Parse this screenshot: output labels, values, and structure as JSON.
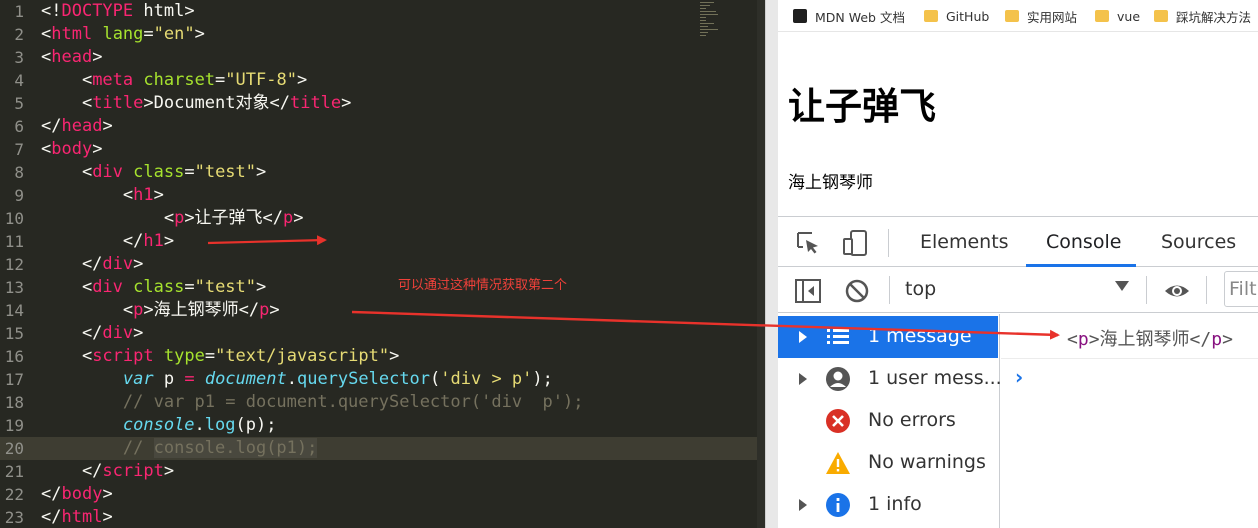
{
  "editor": {
    "lines": [
      {
        "n": "1",
        "parts": [
          [
            "p",
            "<!"
          ],
          [
            "tag",
            "DOCTYPE"
          ],
          [
            "p",
            " html>"
          ]
        ]
      },
      {
        "n": "2",
        "parts": [
          [
            "p",
            "<"
          ],
          [
            "tag",
            "html"
          ],
          [
            "p",
            " "
          ],
          [
            "attr",
            "lang"
          ],
          [
            "p",
            "="
          ],
          [
            "str",
            "\"en\""
          ],
          [
            "p",
            ">"
          ]
        ]
      },
      {
        "n": "3",
        "parts": [
          [
            "p",
            "<"
          ],
          [
            "tag",
            "head"
          ],
          [
            "p",
            ">"
          ]
        ]
      },
      {
        "n": "4",
        "parts": [
          [
            "p",
            "    <"
          ],
          [
            "tag",
            "meta"
          ],
          [
            "p",
            " "
          ],
          [
            "attr",
            "charset"
          ],
          [
            "p",
            "="
          ],
          [
            "str",
            "\"UTF-8\""
          ],
          [
            "p",
            ">"
          ]
        ]
      },
      {
        "n": "5",
        "parts": [
          [
            "p",
            "    <"
          ],
          [
            "tag",
            "title"
          ],
          [
            "p",
            ">Document对象</"
          ],
          [
            "tag",
            "title"
          ],
          [
            "p",
            ">"
          ]
        ]
      },
      {
        "n": "6",
        "parts": [
          [
            "p",
            "</"
          ],
          [
            "tag",
            "head"
          ],
          [
            "p",
            ">"
          ]
        ]
      },
      {
        "n": "7",
        "parts": [
          [
            "p",
            "<"
          ],
          [
            "tag",
            "body"
          ],
          [
            "p",
            ">"
          ]
        ]
      },
      {
        "n": "8",
        "parts": [
          [
            "p",
            "    <"
          ],
          [
            "tag",
            "div"
          ],
          [
            "p",
            " "
          ],
          [
            "attr",
            "class"
          ],
          [
            "p",
            "="
          ],
          [
            "str",
            "\"test\""
          ],
          [
            "p",
            ">"
          ]
        ]
      },
      {
        "n": "9",
        "parts": [
          [
            "p",
            "        <"
          ],
          [
            "tag",
            "h1"
          ],
          [
            "p",
            ">"
          ]
        ]
      },
      {
        "n": "10",
        "parts": [
          [
            "p",
            "            <"
          ],
          [
            "tag",
            "p"
          ],
          [
            "p",
            ">让子弹飞</"
          ],
          [
            "tag",
            "p"
          ],
          [
            "p",
            ">"
          ]
        ]
      },
      {
        "n": "11",
        "parts": [
          [
            "p",
            "        </"
          ],
          [
            "tag",
            "h1"
          ],
          [
            "p",
            ">"
          ]
        ]
      },
      {
        "n": "12",
        "parts": [
          [
            "p",
            "    </"
          ],
          [
            "tag",
            "div"
          ],
          [
            "p",
            ">"
          ]
        ]
      },
      {
        "n": "13",
        "parts": [
          [
            "p",
            "    <"
          ],
          [
            "tag",
            "div"
          ],
          [
            "p",
            " "
          ],
          [
            "attr",
            "class"
          ],
          [
            "p",
            "="
          ],
          [
            "str",
            "\"test\""
          ],
          [
            "p",
            ">"
          ]
        ]
      },
      {
        "n": "14",
        "parts": [
          [
            "p",
            "        <"
          ],
          [
            "tag",
            "p"
          ],
          [
            "p",
            ">海上钢琴师</"
          ],
          [
            "tag",
            "p"
          ],
          [
            "p",
            ">"
          ]
        ]
      },
      {
        "n": "15",
        "parts": [
          [
            "p",
            "    </"
          ],
          [
            "tag",
            "div"
          ],
          [
            "p",
            ">"
          ]
        ]
      },
      {
        "n": "16",
        "parts": [
          [
            "p",
            "    <"
          ],
          [
            "tag",
            "script"
          ],
          [
            "p",
            " "
          ],
          [
            "attr",
            "type"
          ],
          [
            "p",
            "="
          ],
          [
            "str",
            "\"text/javascript\""
          ],
          [
            "p",
            ">"
          ]
        ]
      },
      {
        "n": "17",
        "parts": [
          [
            "p",
            "        "
          ],
          [
            "kw",
            "var"
          ],
          [
            "p",
            " p "
          ],
          [
            "tag",
            "="
          ],
          [
            "p",
            " "
          ],
          [
            "kw",
            "document"
          ],
          [
            "p",
            "."
          ],
          [
            "fn",
            "querySelector"
          ],
          [
            "p",
            "("
          ],
          [
            "str",
            "'div > p'"
          ],
          [
            "p",
            ");"
          ]
        ]
      },
      {
        "n": "18",
        "parts": [
          [
            "p",
            "        "
          ],
          [
            "cmt",
            "// var p1 = document.querySelector('div  p');"
          ]
        ]
      },
      {
        "n": "19",
        "parts": [
          [
            "p",
            "        "
          ],
          [
            "kw",
            "console"
          ],
          [
            "p",
            "."
          ],
          [
            "fn",
            "log"
          ],
          [
            "p",
            "(p);"
          ]
        ]
      },
      {
        "n": "20",
        "parts": [
          [
            "p",
            "        "
          ],
          [
            "cmt",
            "// "
          ],
          [
            "sel",
            "console.log(p1);"
          ]
        ]
      },
      {
        "n": "21",
        "parts": [
          [
            "p",
            "    </"
          ],
          [
            "tag",
            "script"
          ],
          [
            "p",
            ">"
          ]
        ]
      },
      {
        "n": "22",
        "parts": [
          [
            "p",
            "</"
          ],
          [
            "tag",
            "body"
          ],
          [
            "p",
            ">"
          ]
        ]
      },
      {
        "n": "23",
        "parts": [
          [
            "p",
            "</"
          ],
          [
            "tag",
            "html"
          ],
          [
            "p",
            ">"
          ]
        ]
      }
    ],
    "current_line": "20",
    "annotation": "可以通过这种情况获取第二个"
  },
  "bookmarks": [
    {
      "label": "MDN Web 文档",
      "icon": "mdn-icon"
    },
    {
      "label": "GitHub",
      "icon": "folder-icon"
    },
    {
      "label": "实用网站",
      "icon": "folder-icon"
    },
    {
      "label": "vue",
      "icon": "folder-icon"
    },
    {
      "label": "踩坑解决方法",
      "icon": "folder-icon"
    }
  ],
  "page": {
    "h1": "让子弹飞",
    "p": "海上钢琴师"
  },
  "devtools": {
    "tabs": [
      "Elements",
      "Console",
      "Sources"
    ],
    "active_tab": "Console",
    "context": "top",
    "filter_placeholder": "Filt",
    "sidebar": [
      {
        "label": "1 message",
        "icon": "list-icon",
        "expandable": true,
        "selected": true
      },
      {
        "label": "1 user mess...",
        "icon": "user-icon",
        "expandable": true,
        "selected": false
      },
      {
        "label": "No errors",
        "icon": "error-icon",
        "expandable": false,
        "selected": false
      },
      {
        "label": "No warnings",
        "icon": "warning-icon",
        "expandable": false,
        "selected": false
      },
      {
        "label": "1 info",
        "icon": "info-icon",
        "expandable": true,
        "selected": false
      }
    ],
    "log": {
      "open": "<",
      "tag": "p",
      "close_a": ">",
      "text": "海上钢琴师",
      "close_b": "</",
      "close_c": ">"
    },
    "prompt": "›"
  },
  "colors": {
    "editor_bg": "#272822",
    "accent": "#1a73e8",
    "annotation": "#f0413a"
  }
}
